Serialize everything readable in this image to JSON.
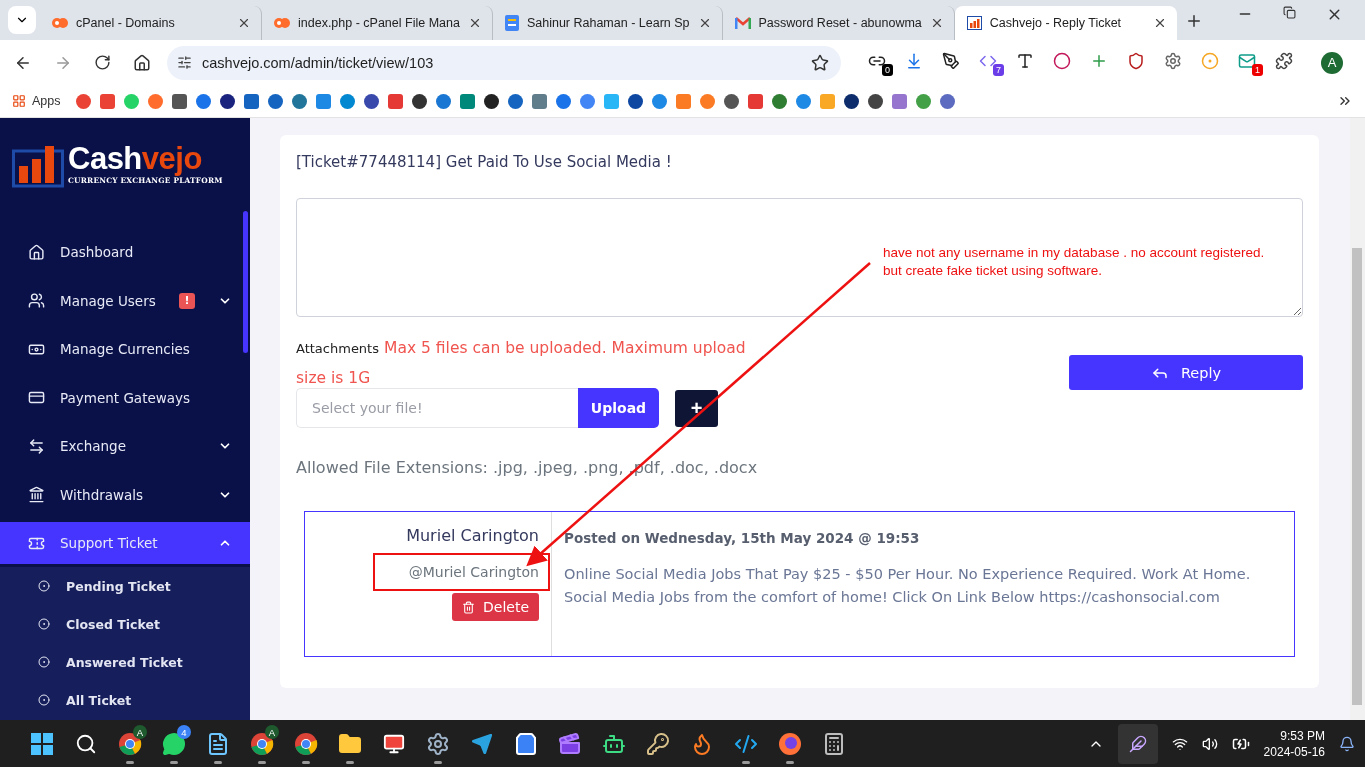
{
  "browser": {
    "tabs": [
      {
        "title": "cPanel - Domains",
        "kind": "cpanel",
        "selected": false
      },
      {
        "title": "index.php - cPanel File Mana",
        "kind": "cpanel",
        "selected": false
      },
      {
        "title": "Sahinur Rahaman - Learn Sp",
        "kind": "sites",
        "selected": false
      },
      {
        "title": "Password Reset - abunowma",
        "kind": "gmail",
        "selected": false
      },
      {
        "title": "Cashvejo - Reply Ticket",
        "kind": "chart",
        "selected": true
      }
    ],
    "url": "cashvejo.com/admin/ticket/view/103",
    "extensions": [
      {
        "kind": "link",
        "badge": "0"
      },
      {
        "kind": "download"
      },
      {
        "kind": "pen"
      },
      {
        "kind": "php",
        "badge": "7"
      },
      {
        "kind": "font"
      },
      {
        "kind": "ring"
      },
      {
        "kind": "plus"
      },
      {
        "kind": "shield"
      },
      {
        "kind": "gear"
      },
      {
        "kind": "target"
      },
      {
        "kind": "mail",
        "badge": "1"
      },
      {
        "kind": "puzzle"
      }
    ],
    "profile_initial": "A",
    "apps_label": "Apps"
  },
  "sidebar": {
    "logo": {
      "first": "Cash",
      "second": "vejo",
      "tagline": "CURRENCY EXCHANGE PLATFORM"
    },
    "items": [
      {
        "label": "Dashboard",
        "kind": "home",
        "selected": false
      },
      {
        "label": "Manage Users",
        "kind": "users",
        "selected": false,
        "badge": "!",
        "expanded": false
      },
      {
        "label": "Manage Currencies",
        "kind": "currency",
        "selected": false
      },
      {
        "label": "Payment Gateways",
        "kind": "card",
        "selected": false
      },
      {
        "label": "Exchange",
        "kind": "exchange",
        "selected": false,
        "expanded": false
      },
      {
        "label": "Withdrawals",
        "kind": "bank",
        "selected": false,
        "expanded": false
      },
      {
        "label": "Support Ticket",
        "kind": "ticket",
        "selected": true,
        "expanded": true,
        "children": [
          {
            "label": "Pending Ticket"
          },
          {
            "label": "Closed Ticket"
          },
          {
            "label": "Answered Ticket"
          },
          {
            "label": "All Ticket"
          }
        ]
      }
    ]
  },
  "ticket": {
    "title": "[Ticket#77448114] Get Paid To Use Social Media !",
    "attachments_label": "Attachments",
    "attachments_note": "Max 5 files can be uploaded. Maximum upload size is 1G",
    "file_placeholder": "Select your file!",
    "upload_button": "Upload",
    "add_button": "+",
    "reply_button": "Reply",
    "allowed_extensions": "Allowed File Extensions: .jpg, .jpeg, .png, .pdf, .doc, .docx",
    "messages": [
      {
        "author": "Muriel Carington",
        "username": "@Muriel Carington",
        "delete_button": "Delete",
        "posted": "Posted on Wednesday, 15th May 2024 @ 19:53",
        "body": "Online Social Media Jobs That Pay $25 - $50 Per Hour. No Experience Required. Work At Home. Social Media Jobs from the comfort of home! Click On Link Below https://cashonsocial.com"
      }
    ]
  },
  "annotation": {
    "note_lines": [
      "have not any username in my database . no account registered.",
      "but create fake ticket using software."
    ]
  },
  "taskbar": {
    "apps": [
      {
        "kind": "start",
        "running": false
      },
      {
        "kind": "search",
        "running": false
      },
      {
        "kind": "chrome",
        "running": true,
        "badge": "A"
      },
      {
        "kind": "whatsapp",
        "running": true,
        "badge": "4"
      },
      {
        "kind": "notepad",
        "running": true
      },
      {
        "kind": "chrome",
        "running": true,
        "badge": "A"
      },
      {
        "kind": "chrome",
        "running": true
      },
      {
        "kind": "files",
        "running": true
      },
      {
        "kind": "anydesk",
        "running": false
      },
      {
        "kind": "settings",
        "running": true
      },
      {
        "kind": "telegram",
        "running": false
      },
      {
        "kind": "store",
        "running": false
      },
      {
        "kind": "clapper",
        "running": false
      },
      {
        "kind": "android",
        "running": false
      },
      {
        "kind": "keys",
        "running": false
      },
      {
        "kind": "xampp",
        "running": false
      },
      {
        "kind": "vscode",
        "running": true
      },
      {
        "kind": "firefox",
        "running": true
      },
      {
        "kind": "calculator",
        "running": false
      }
    ],
    "time": "9:53 PM",
    "date": "2024-05-16"
  }
}
